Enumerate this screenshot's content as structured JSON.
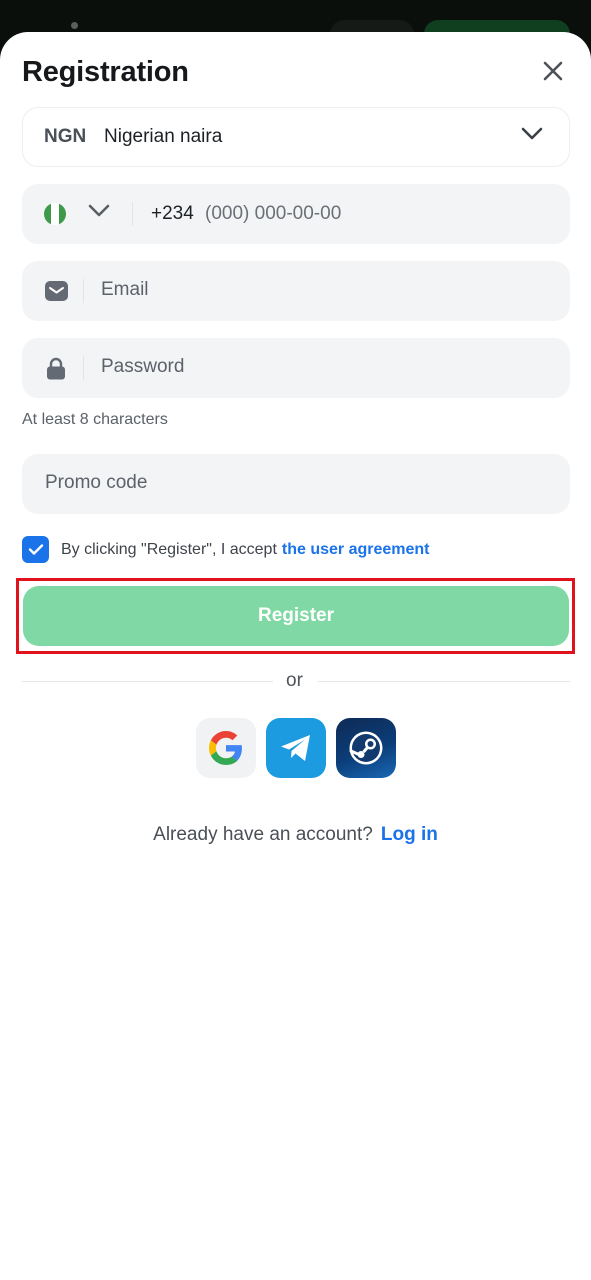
{
  "sheet": {
    "title": "Registration",
    "close_icon": "close-icon"
  },
  "currency": {
    "code": "NGN",
    "name": "Nigerian naira"
  },
  "phone": {
    "country_code": "+234",
    "placeholder": "(000) 000-00-00",
    "flag_colors": [
      "#3e9a4a",
      "#ffffff",
      "#3e9a4a"
    ]
  },
  "email": {
    "placeholder": "Email",
    "icon": "mail-icon"
  },
  "password": {
    "placeholder": "Password",
    "icon": "lock-icon",
    "hint": "At least 8 characters"
  },
  "promo": {
    "placeholder": "Promo code"
  },
  "agreement": {
    "checked": true,
    "text": "By clicking \"Register\", I accept",
    "link": "the user agreement"
  },
  "register": {
    "label": "Register"
  },
  "divider": {
    "label": "or"
  },
  "social": {
    "providers": [
      "google-icon",
      "telegram-icon",
      "steam-icon"
    ]
  },
  "login": {
    "prompt": "Already have an account?",
    "link": "Log in"
  },
  "colors": {
    "accent": "#1a73e8",
    "register_bg": "#80d9a4",
    "highlight": "#e0121b"
  }
}
